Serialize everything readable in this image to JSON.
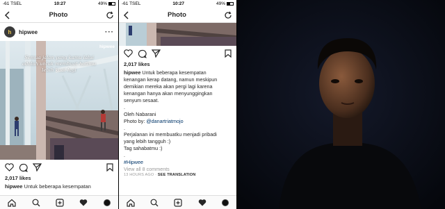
{
  "left_phone": {
    "status": {
      "carrier": "-61 TSEL",
      "time": "10:27",
      "battery": "49%",
      "battery_level": 0.49
    },
    "nav": {
      "title": "Photo"
    },
    "post": {
      "username": "hipwee",
      "avatar_letter": "h",
      "watermark": "hipwee",
      "quote": "Semua jalan yang kamu lalui adalah untuk membuat hatimu lebih kuat lagi"
    },
    "likes": "2,017 likes",
    "caption_user": "hipwee",
    "caption_text": "Untuk beberapa kesempatan"
  },
  "right_phone": {
    "status": {
      "carrier": "-61 TSEL",
      "time": "10:27",
      "battery": "49%",
      "battery_level": 0.49
    },
    "nav": {
      "title": "Photo"
    },
    "likes": "2,017 likes",
    "caption_user": "hipwee",
    "caption_lines": [
      "Untuk beberapa kesempatan",
      "kenangan kerap datang, namun meskipun",
      "demikian mereka akan pergi lagi karena",
      "kenangan hanya akan menyunggingkan",
      "senyum sesaat."
    ],
    "dot1": ".",
    "author": "Oleh Nabarani",
    "photo_by_label": "Photo by:",
    "photo_by_handle": "@danartriatmojo",
    "dot2": ".",
    "reflection_1": "Perjalanan ini membuatku menjadi pribadi",
    "reflection_2": "yang lebih tangguh :)",
    "tag": "Tag sahabatmu :)",
    "dot3": ".",
    "hashtag": "#Hipwee",
    "view_comments": "View all 8 comments",
    "time_ago": "13 HOURS AGO",
    "see_translation": "SEE TRANSLATION"
  },
  "icons": {
    "back": "chevron-left-icon",
    "refresh": "refresh-icon",
    "heart": "heart-icon",
    "comment": "comment-icon",
    "share": "send-icon",
    "bookmark": "bookmark-icon",
    "home": "home-icon",
    "search": "search-icon",
    "add": "add-post-icon",
    "activity": "activity-heart-icon",
    "profile": "profile-icon"
  },
  "colors": {
    "link": "#003569",
    "muted": "#999999",
    "text": "#262626",
    "avatar_letter": "#e6c04a"
  }
}
